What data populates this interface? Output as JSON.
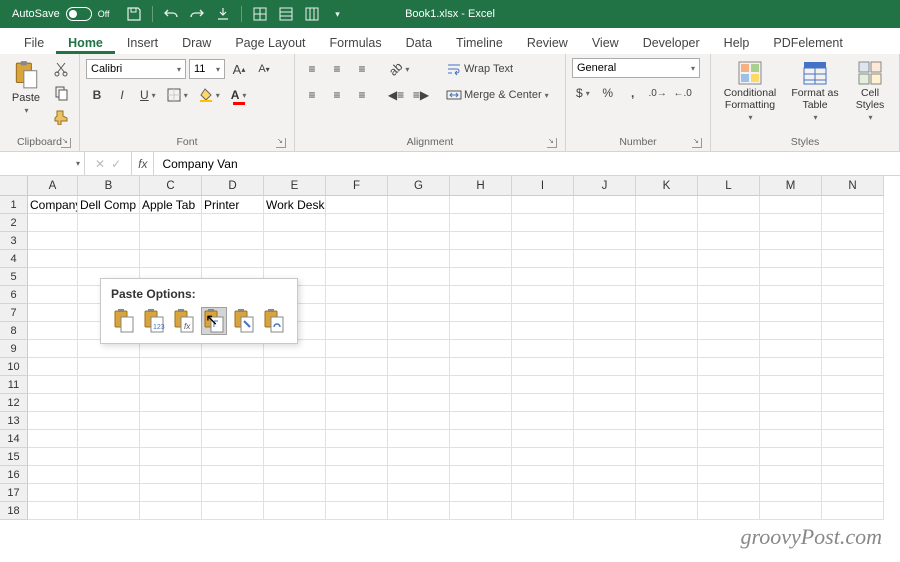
{
  "titlebar": {
    "autosave_label": "AutoSave",
    "autosave_state": "Off",
    "title": "Book1.xlsx - Excel"
  },
  "tabs": [
    "File",
    "Home",
    "Insert",
    "Draw",
    "Page Layout",
    "Formulas",
    "Data",
    "Timeline",
    "Review",
    "View",
    "Developer",
    "Help",
    "PDFelement"
  ],
  "active_tab": "Home",
  "ribbon": {
    "clipboard": {
      "label": "Clipboard",
      "paste": "Paste"
    },
    "font": {
      "label": "Font",
      "name": "Calibri",
      "size": "11"
    },
    "alignment": {
      "label": "Alignment",
      "wrap": "Wrap Text",
      "merge": "Merge & Center"
    },
    "number": {
      "label": "Number",
      "format": "General"
    },
    "styles": {
      "label": "Styles",
      "conditional": "Conditional Formatting",
      "format_table": "Format as Table",
      "cell_styles": "Cell Styles"
    }
  },
  "formula_bar": {
    "name_box": "",
    "formula": "Company Van"
  },
  "columns": [
    "A",
    "B",
    "C",
    "D",
    "E",
    "F",
    "G",
    "H",
    "I",
    "J",
    "K",
    "L",
    "M",
    "N"
  ],
  "row_count": 18,
  "cells": {
    "A1": "Company",
    "B1": "Dell Comp",
    "C1": "Apple Tab",
    "D1": "Printer",
    "E1": "Work Desk"
  },
  "paste_popup": {
    "title": "Paste Options:",
    "options": [
      "paste",
      "values-123",
      "formulas-fx",
      "transpose",
      "formatting",
      "paste-link"
    ]
  },
  "watermark": "groovyPost.com"
}
